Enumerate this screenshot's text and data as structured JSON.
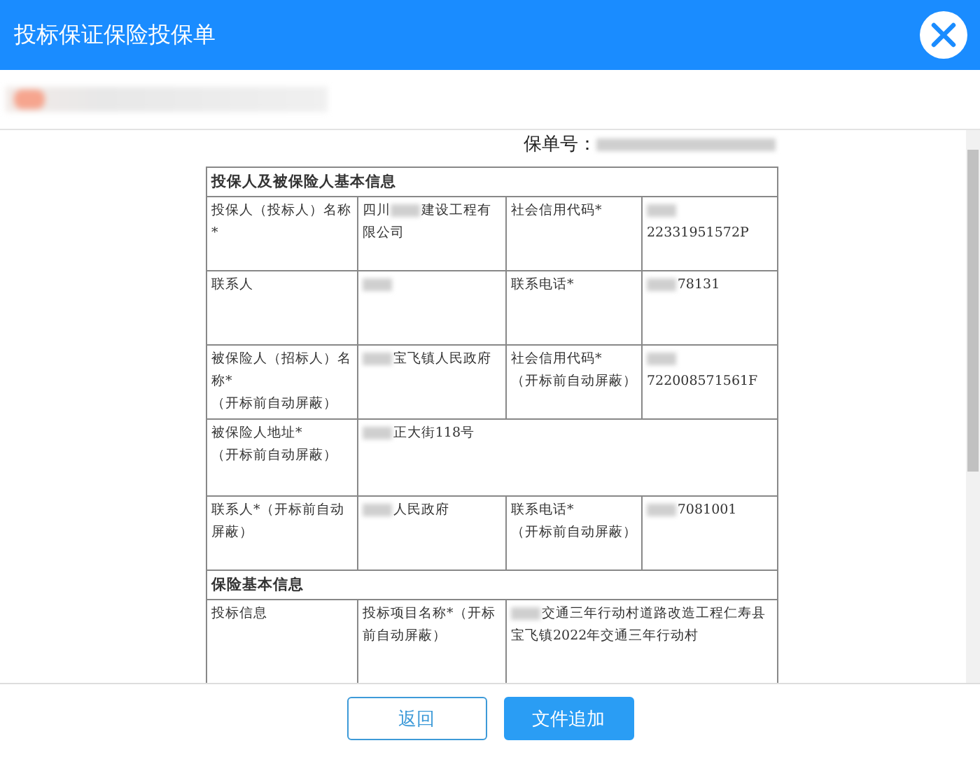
{
  "window": {
    "title": "投标保证保险投保单"
  },
  "subtitle_redacted": true,
  "policy_no": {
    "label": "保单号：",
    "parts": [
      {
        "kind": "blur"
      }
    ]
  },
  "table": {
    "rows": [
      {
        "kind": "section",
        "title": "投保人及被保险人基本信息"
      },
      {
        "kind": "pair",
        "cells": [
          {
            "lines": [
              "投保人（投标人）名称*"
            ]
          },
          {
            "parts": [
              {
                "kind": "text",
                "text": "四川"
              },
              {
                "kind": "blur"
              },
              {
                "kind": "text",
                "text": "建设工程有限公司"
              }
            ]
          },
          {
            "lines": [
              "社会信用代码*"
            ]
          },
          {
            "parts": [
              {
                "kind": "blur"
              },
              {
                "kind": "text",
                "text": "22331951572P"
              }
            ]
          }
        ]
      },
      {
        "kind": "pair",
        "cells": [
          {
            "lines": [
              "联系人"
            ]
          },
          {
            "parts": [
              {
                "kind": "blur"
              }
            ]
          },
          {
            "lines": [
              "联系电话*"
            ]
          },
          {
            "parts": [
              {
                "kind": "blur"
              },
              {
                "kind": "text",
                "text": "78131"
              }
            ]
          }
        ]
      },
      {
        "kind": "pair",
        "cells": [
          {
            "lines": [
              "被保险人（招标人）名称*",
              "（开标前自动屏蔽）"
            ]
          },
          {
            "parts": [
              {
                "kind": "blur"
              },
              {
                "kind": "text",
                "text": "宝飞镇人民政府"
              }
            ]
          },
          {
            "lines": [
              "社会信用代码*",
              "（开标前自动屏蔽）"
            ]
          },
          {
            "parts": [
              {
                "kind": "blur"
              },
              {
                "kind": "text",
                "text": "722008571561F"
              }
            ]
          }
        ]
      },
      {
        "kind": "wide",
        "cells": [
          {
            "lines": [
              "被保险人地址*",
              "（开标前自动屏蔽）"
            ]
          },
          {
            "parts": [
              {
                "kind": "blur"
              },
              {
                "kind": "text",
                "text": "正大街118号"
              }
            ]
          }
        ]
      },
      {
        "kind": "pair",
        "cells": [
          {
            "lines": [
              "联系人*（开标前自动屏蔽）"
            ]
          },
          {
            "parts": [
              {
                "kind": "blur"
              },
              {
                "kind": "text",
                "text": "人民政府"
              }
            ]
          },
          {
            "lines": [
              "联系电话*",
              "（开标前自动屏蔽）"
            ]
          },
          {
            "parts": [
              {
                "kind": "blur"
              },
              {
                "kind": "text",
                "text": "7081001"
              }
            ]
          }
        ]
      },
      {
        "kind": "section",
        "title": "保险基本信息"
      },
      {
        "kind": "group",
        "cells": [
          {
            "lines": [
              "投标信息"
            ]
          },
          {
            "lines": [
              "投标项目名称*（开标前自动屏蔽）"
            ]
          },
          {
            "parts": [
              {
                "kind": "blur"
              },
              {
                "kind": "text",
                "text": "交通三年行动村道路改造工程仁寿县宝飞镇2022年交通三年行动村"
              }
            ]
          }
        ]
      }
    ]
  },
  "buttons": [
    {
      "label": "返回",
      "kind": "secondary"
    },
    {
      "label": "文件追加",
      "kind": "primary"
    }
  ]
}
